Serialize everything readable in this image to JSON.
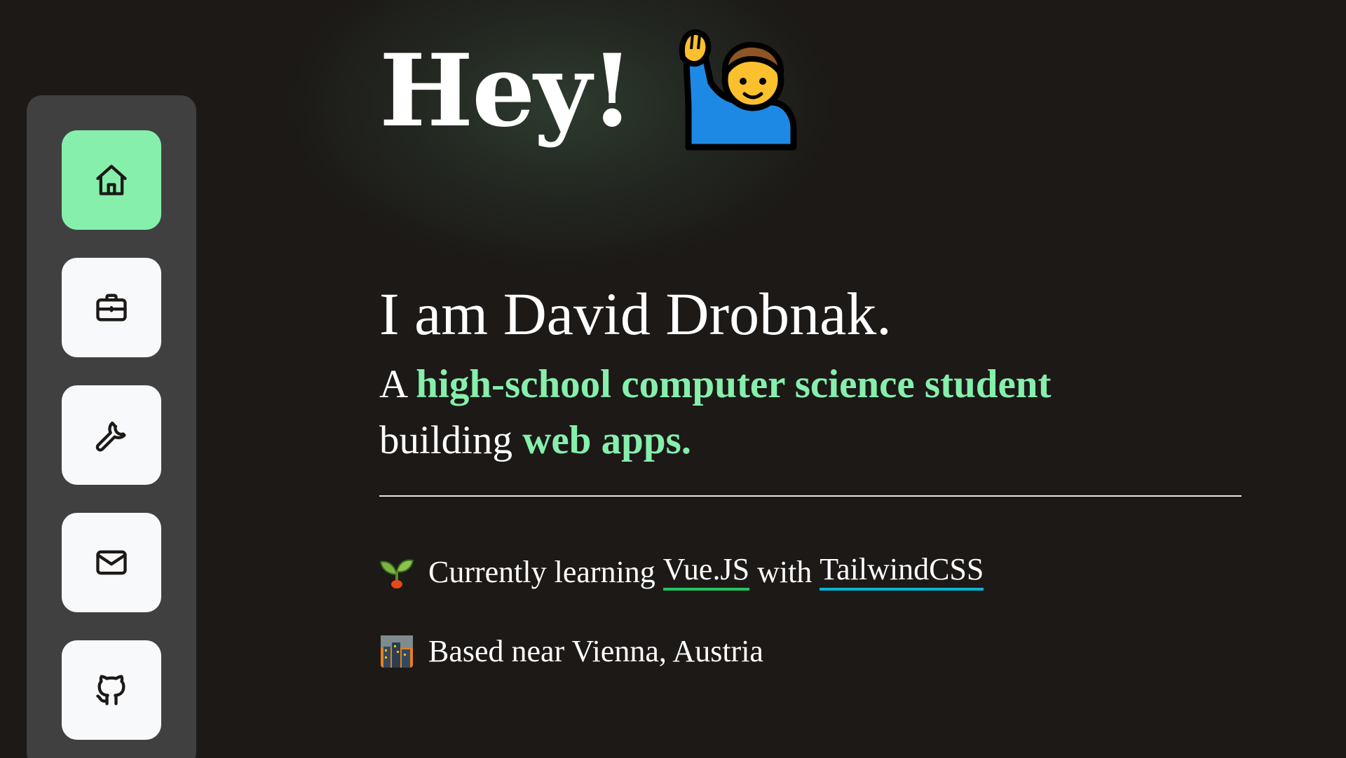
{
  "nav": {
    "items": [
      {
        "icon": "home-icon",
        "active": true
      },
      {
        "icon": "briefcase-icon",
        "active": false
      },
      {
        "icon": "wrench-icon",
        "active": false
      },
      {
        "icon": "mail-icon",
        "active": false
      },
      {
        "icon": "github-icon",
        "active": false
      }
    ]
  },
  "hero": {
    "greeting": "Hey!",
    "greeting_icon": "raising-hand-man-icon",
    "intro": "I am David Drobnak.",
    "tagline_prefix": "A ",
    "tagline_highlight_1": "high-school computer science student",
    "tagline_middle": "building ",
    "tagline_highlight_2": "web apps."
  },
  "facts": {
    "learning": {
      "icon": "seedling-icon",
      "prefix": "Currently learning ",
      "link_1": "Vue.JS",
      "middle": " with ",
      "link_2": "TailwindCSS"
    },
    "location": {
      "icon": "cityscape-icon",
      "text": "Based near Vienna, Austria"
    }
  },
  "colors": {
    "background": "#1c1917",
    "sidebar": "#404040",
    "accent": "#86efac",
    "vue_underline": "#22c55e",
    "tailwind_underline": "#06b6d4"
  }
}
